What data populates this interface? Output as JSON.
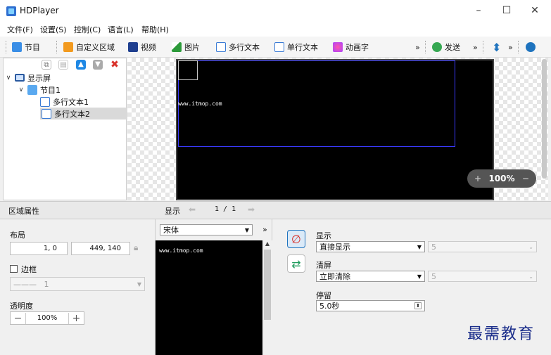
{
  "window": {
    "title": "HDPlayer",
    "controls": [
      "–",
      "☐",
      "✕"
    ]
  },
  "menu": [
    "文件(F)",
    "设置(S)",
    "控制(C)",
    "语言(L)",
    "帮助(H)"
  ],
  "toolbar": {
    "program": "节目",
    "custom_area": "自定义区域",
    "video": "视频",
    "image": "图片",
    "multiline_text": "多行文本",
    "single_line_text": "单行文本",
    "animated_text": "动画字",
    "more1": "»",
    "send": "发送",
    "more2": "»",
    "more3": "»"
  },
  "tree": {
    "root": "显示屏",
    "program": "节目1",
    "items": [
      "多行文本1",
      "多行文本2"
    ],
    "selected": "多行文本2"
  },
  "preview": {
    "screen_text": "www.itmop.com",
    "zoom": "100%",
    "zoom_in": "+",
    "zoom_out": "−"
  },
  "region_props": {
    "header": "区域属性",
    "layout_label": "布局",
    "position": "1, 0",
    "size": "449, 140",
    "border_label": "边框",
    "border_value": "1",
    "opacity_label": "透明度",
    "opacity_value": "100%",
    "minus": "−",
    "plus": "+"
  },
  "display_nav": {
    "label": "显示",
    "page": "1 / 1",
    "font": "宋体",
    "more": "»",
    "preview_text": "www.itmop.com"
  },
  "effects": {
    "display_label": "显示",
    "display_value": "直接显示",
    "display_speed": "5",
    "clear_label": "清屏",
    "clear_value": "立即清除",
    "clear_speed": "5",
    "stay_label": "停留",
    "stay_value": "5.0秒"
  },
  "watermark": "最需教育",
  "colors": {
    "accent": "#1e73be",
    "screen": "#000000",
    "region_border": "#3a3aff",
    "watermark": "#1a2d8a"
  }
}
